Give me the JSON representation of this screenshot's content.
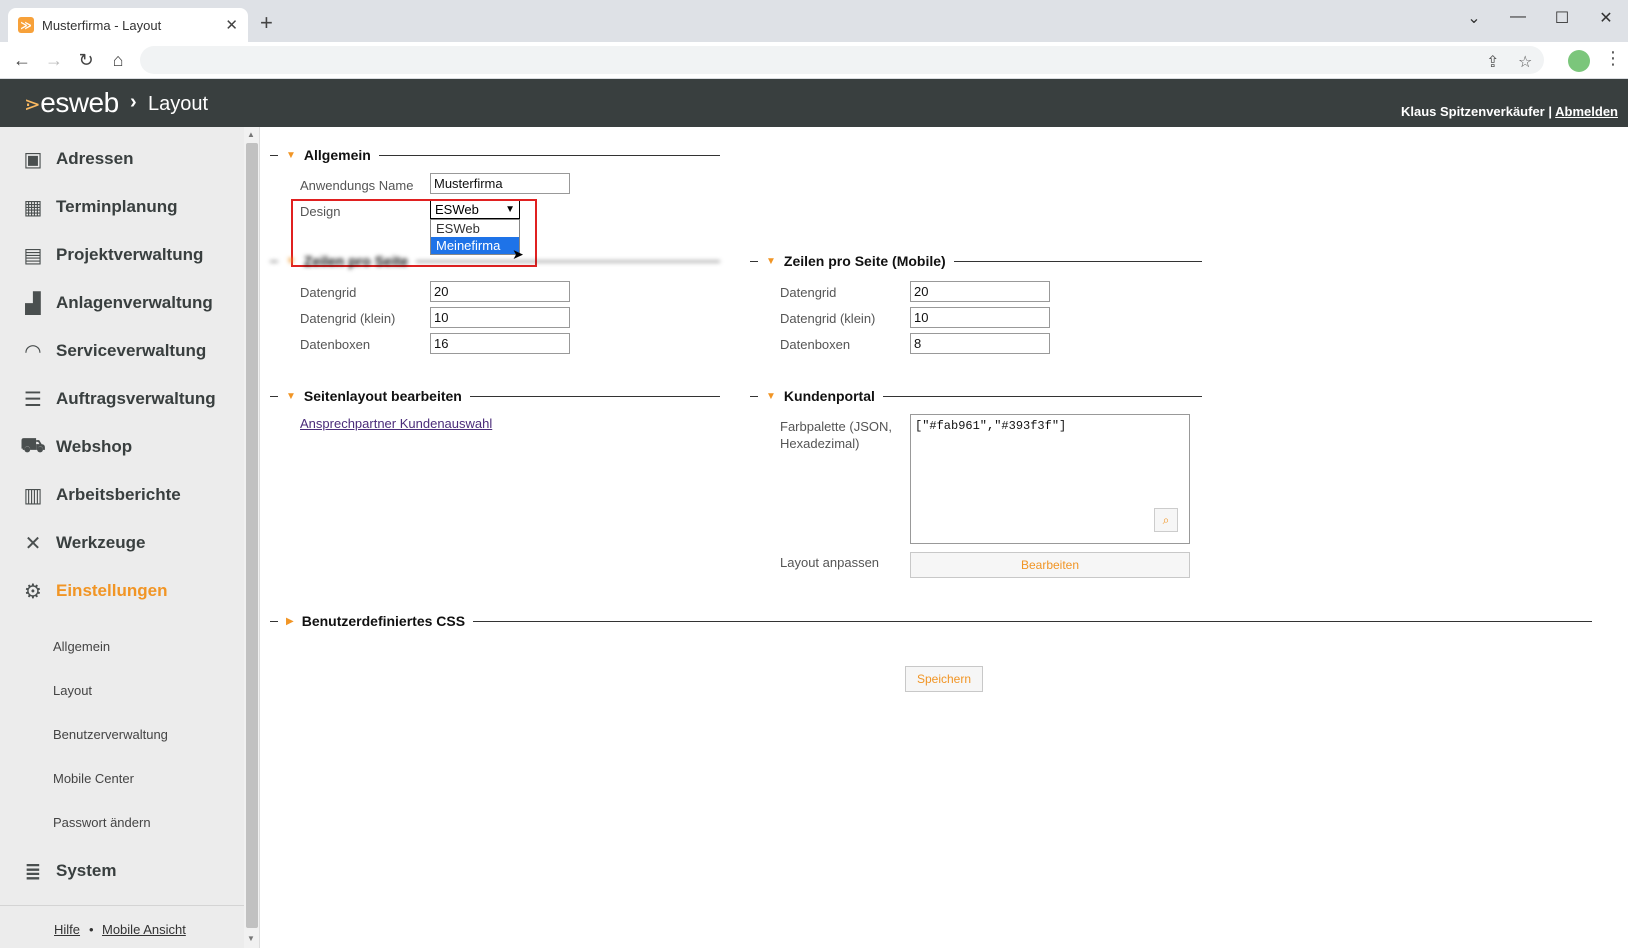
{
  "browser": {
    "tab_title": "Musterfirma - Layout",
    "tab_close": "✕",
    "new_tab": "+",
    "favicon": "≫"
  },
  "header": {
    "logo_text": "esweb",
    "breadcrumb_sep": "›",
    "page_title": "Layout",
    "user_name": "Klaus Spitzenverkäufer",
    "separator": "|",
    "logout": "Abmelden"
  },
  "sidebar": {
    "items": [
      {
        "label": "Adressen",
        "icon": "address-book-icon"
      },
      {
        "label": "Terminplanung",
        "icon": "calendar-icon"
      },
      {
        "label": "Projektverwaltung",
        "icon": "gantt-icon"
      },
      {
        "label": "Anlagenverwaltung",
        "icon": "factory-icon"
      },
      {
        "label": "Serviceverwaltung",
        "icon": "headset-icon"
      },
      {
        "label": "Auftragsverwaltung",
        "icon": "list-icon"
      },
      {
        "label": "Webshop",
        "icon": "cart-icon"
      },
      {
        "label": "Arbeitsberichte",
        "icon": "clipboard-icon"
      },
      {
        "label": "Werkzeuge",
        "icon": "tools-icon"
      },
      {
        "label": "Einstellungen",
        "icon": "gears-icon"
      },
      {
        "label": "System",
        "icon": "database-icon"
      }
    ],
    "subitems": [
      "Allgemein",
      "Layout",
      "Benutzerverwaltung",
      "Mobile Center",
      "Passwort ändern"
    ],
    "footer": {
      "help": "Hilfe",
      "dot": "•",
      "mobile": "Mobile Ansicht"
    }
  },
  "main": {
    "allgemein": {
      "title": "Allgemein",
      "app_name_label": "Anwendungs Name",
      "app_name_value": "Musterfirma",
      "design_label": "Design",
      "design_selected": "ESWeb",
      "design_options": [
        "ESWeb",
        "Meinefirma"
      ]
    },
    "zeilen": {
      "title": "Zeilen pro Seite",
      "datengrid_label": "Datengrid",
      "datengrid_value": "20",
      "datengrid_klein_label": "Datengrid (klein)",
      "datengrid_klein_value": "10",
      "datenboxen_label": "Datenboxen",
      "datenboxen_value": "16"
    },
    "zeilen_mobile": {
      "title": "Zeilen pro Seite (Mobile)",
      "datengrid_label": "Datengrid",
      "datengrid_value": "20",
      "datengrid_klein_label": "Datengrid (klein)",
      "datengrid_klein_value": "10",
      "datenboxen_label": "Datenboxen",
      "datenboxen_value": "8"
    },
    "seitenlayout": {
      "title": "Seitenlayout bearbeiten",
      "link": "Ansprechpartner Kundenauswahl"
    },
    "kundenportal": {
      "title": "Kundenportal",
      "farbpalette_label_1": "Farbpalette (JSON,",
      "farbpalette_label_2": "Hexadezimal)",
      "farbpalette_value": "[\"#fab961\",\"#393f3f\"]",
      "layout_label": "Layout anpassen",
      "edit_button": "Bearbeiten"
    },
    "css": {
      "title": "Benutzerdefiniertes CSS"
    },
    "save_button": "Speichern"
  },
  "colors": {
    "accent": "#f19525",
    "header_bg": "#393f3f",
    "sidebar_bg": "#ececec",
    "highlight": "#e02020",
    "option_selected": "#1e73e8"
  }
}
